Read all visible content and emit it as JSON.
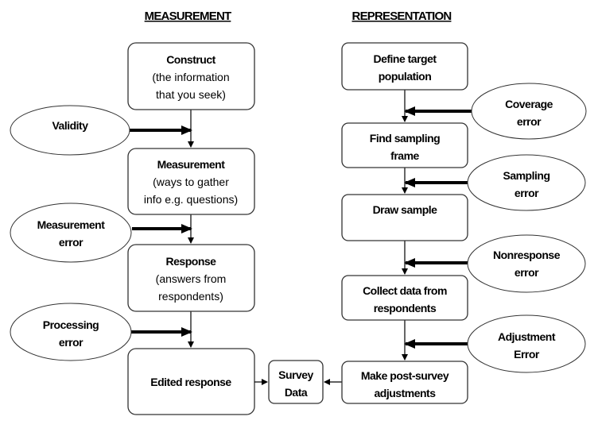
{
  "headings": {
    "measurement": "MEASUREMENT",
    "representation": "REPRESENTATION"
  },
  "measurement_column": {
    "boxes": [
      {
        "id": "construct",
        "title": "Construct",
        "subtitle_lines": [
          "(the information",
          "that you seek)"
        ]
      },
      {
        "id": "measurement",
        "title": "Measurement",
        "subtitle_lines": [
          "(ways to gather",
          "info e.g. questions)"
        ]
      },
      {
        "id": "response",
        "title": "Response",
        "subtitle_lines": [
          "(answers from",
          "respondents)"
        ]
      },
      {
        "id": "edited-response",
        "title": "Edited response",
        "subtitle_lines": []
      }
    ],
    "error_sources": [
      {
        "id": "validity",
        "lines": [
          "Validity"
        ]
      },
      {
        "id": "measurement-error",
        "lines": [
          "Measurement",
          "error"
        ]
      },
      {
        "id": "processing-error",
        "lines": [
          "Processing",
          "error"
        ]
      }
    ]
  },
  "representation_column": {
    "boxes": [
      {
        "id": "define-target-population",
        "lines": [
          "Define target",
          "population"
        ]
      },
      {
        "id": "find-sampling-frame",
        "lines": [
          "Find sampling",
          "frame"
        ]
      },
      {
        "id": "draw-sample",
        "lines": [
          "Draw sample"
        ]
      },
      {
        "id": "collect-data",
        "lines": [
          "Collect data from",
          "respondents"
        ]
      },
      {
        "id": "post-survey-adjustments",
        "lines": [
          "Make post-survey",
          "adjustments"
        ]
      }
    ],
    "error_sources": [
      {
        "id": "coverage-error",
        "lines": [
          "Coverage",
          "error"
        ]
      },
      {
        "id": "sampling-error",
        "lines": [
          "Sampling",
          "error"
        ]
      },
      {
        "id": "nonresponse-error",
        "lines": [
          "Nonresponse",
          "error"
        ]
      },
      {
        "id": "adjustment-error",
        "lines": [
          "Adjustment",
          "Error"
        ]
      }
    ]
  },
  "center": {
    "survey_data_lines": [
      "Survey",
      "Data"
    ]
  }
}
